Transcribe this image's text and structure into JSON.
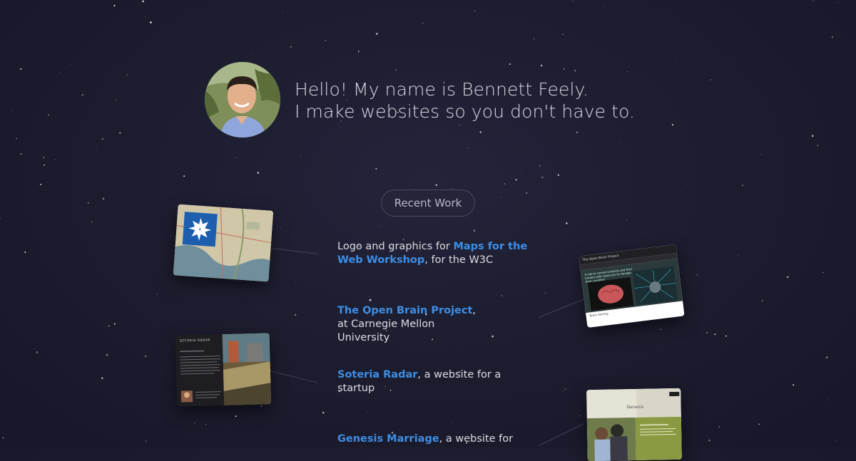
{
  "intro": {
    "line1": "Hello! My name is Bennett Feely.",
    "line2": "I make websites so you don't have to."
  },
  "recent_work": {
    "label": "Recent Work",
    "items": [
      {
        "link": "Maps for the Web Workshop",
        "prefix": "Logo and graphics for ",
        "suffix": ", for the W3C"
      },
      {
        "link": "The Open Brain Project",
        "prefix": "",
        "suffix": ", at Carnegie Mellon University"
      },
      {
        "link": "Soteria Radar",
        "prefix": "",
        "suffix": ", a website for a startup"
      },
      {
        "link": "Genesis Marriage",
        "prefix": "",
        "suffix": ", a website for"
      }
    ]
  },
  "thumbnails": {
    "brain": {
      "title": "The Open Brain Project",
      "tagline": "A hub to connect projects and their funders with resources to manage their condition",
      "caption": "Brain Sorting"
    },
    "soteria": {
      "brand": "SOTERIA RADAR"
    },
    "genesis": {
      "brand": "Genesis"
    }
  },
  "colors": {
    "background": "#1c1c2e",
    "link": "#3d8ee6",
    "text": "#dcdce4"
  }
}
